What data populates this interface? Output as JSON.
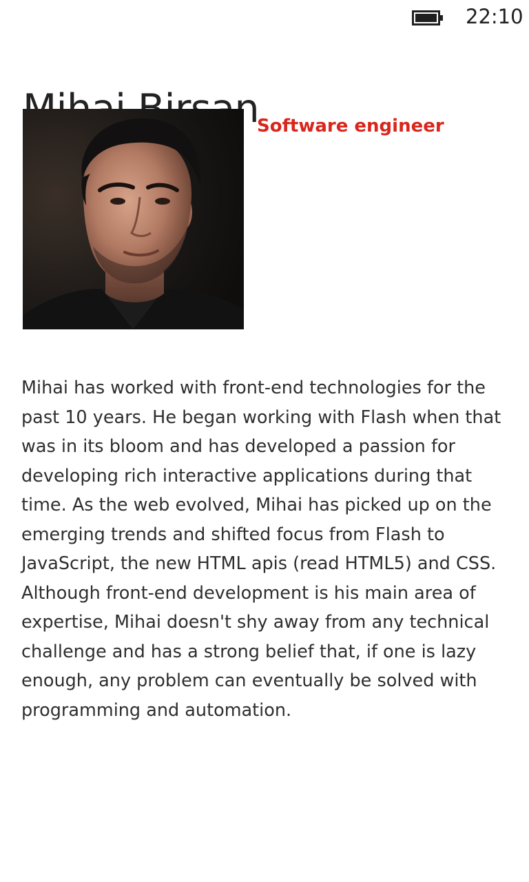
{
  "status_bar": {
    "battery_icon": "battery-icon",
    "battery_level": 0.85,
    "time": "22:10"
  },
  "profile": {
    "name": "Mihai Birsan",
    "job_title": "Software engineer",
    "photo_icon": "profile-photo",
    "bio_paragraphs": [
      "Mihai has worked with front-end technologies for the past 10 years. He began working with Flash when that was in its bloom and has developed a passion for developing rich interactive applications during that time. As the web evolved, Mihai has picked up on the emerging trends and shifted focus from Flash to JavaScript, the new HTML apis (read HTML5) and CSS.",
      "Although front-end development is his main area of expertise, Mihai doesn't shy away from any technical challenge and has a strong belief that, if one is lazy enough, any problem can eventually be solved with programming and automation."
    ]
  },
  "colors": {
    "accent": "#d9261c",
    "text": "#2e2e2e",
    "background": "#ffffff"
  }
}
